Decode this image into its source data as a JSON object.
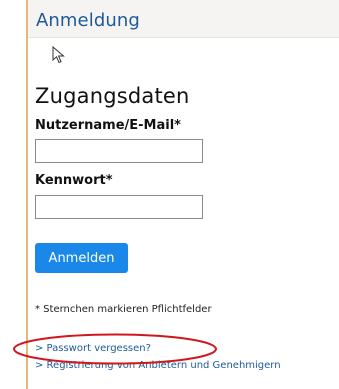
{
  "header": {
    "title": "Anmeldung"
  },
  "form": {
    "section_title": "Zugangsdaten",
    "username_label": "Nutzername/E-Mail*",
    "username_value": "",
    "password_label": "Kennwort*",
    "password_value": "",
    "submit_label": "Anmelden",
    "required_note": "* Sternchen markieren Pflichtfelder"
  },
  "links": {
    "forgot_password": "> Passwort vergessen?",
    "register": "> Registrierung von Anbietern und Genehmigern"
  },
  "icons": {
    "pointer": "mouse-pointer-icon"
  },
  "colors": {
    "accent_button": "#1a88e8",
    "header_title": "#1f5a96",
    "link": "#1f5a96",
    "highlight": "#d0171c",
    "side_rule": "#e3b97a"
  }
}
